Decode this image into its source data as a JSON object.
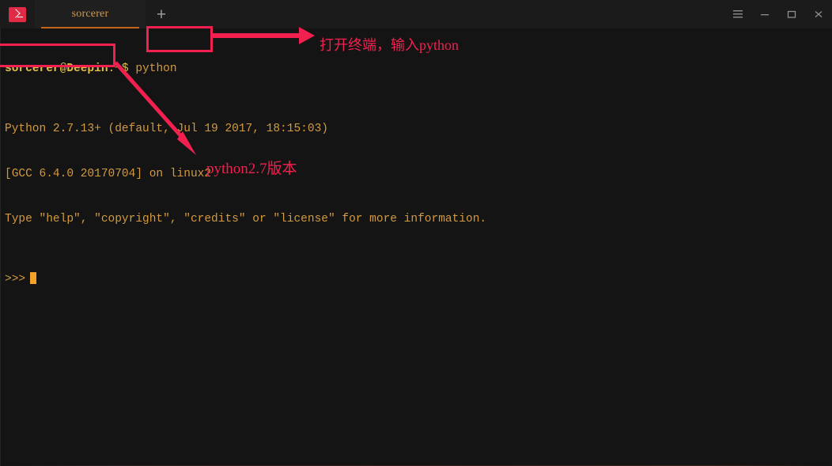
{
  "window": {
    "app_icon": "terminal-icon",
    "tabs": [
      {
        "label": "sorcerer",
        "active": true
      }
    ],
    "new_tab_label": "+",
    "controls": [
      {
        "name": "menu-button",
        "glyph": "hamburger-icon"
      },
      {
        "name": "minimize-button",
        "glyph": "minimize-icon"
      },
      {
        "name": "maximize-button",
        "glyph": "maximize-icon"
      },
      {
        "name": "close-button",
        "glyph": "close-icon"
      }
    ]
  },
  "terminal": {
    "prompt_user": "sorcerer@Deepin",
    "prompt_path": ":~$",
    "command": " python",
    "lines": [
      "Python 2.7.13+ (default, Jul 19 2017, 18:15:03)",
      "[GCC 6.4.0 20170704] on linux2",
      "Type \"help\", \"copyright\", \"credits\" or \"license\" for more information."
    ],
    "ps2": ">>>"
  },
  "annotations": {
    "accent_color": "#f2204e",
    "box_command_label": "python-command-highlight",
    "box_version_label": "python-version-highlight",
    "callout_open_terminal": "打开终端，输入python",
    "callout_version": "python2.7版本"
  },
  "colors": {
    "terminal_bg": "#141414",
    "titlebar_bg": "#1b1b1b",
    "tab_bg": "#1f1f1f",
    "tab_text": "#d89a4a",
    "tab_underline": "#c3651a",
    "terminal_text": "#d39a3e",
    "prompt_text": "#e0c04a",
    "cursor": "#f2a227",
    "annotation": "#f2204e",
    "app_icon": "#e02a46"
  }
}
